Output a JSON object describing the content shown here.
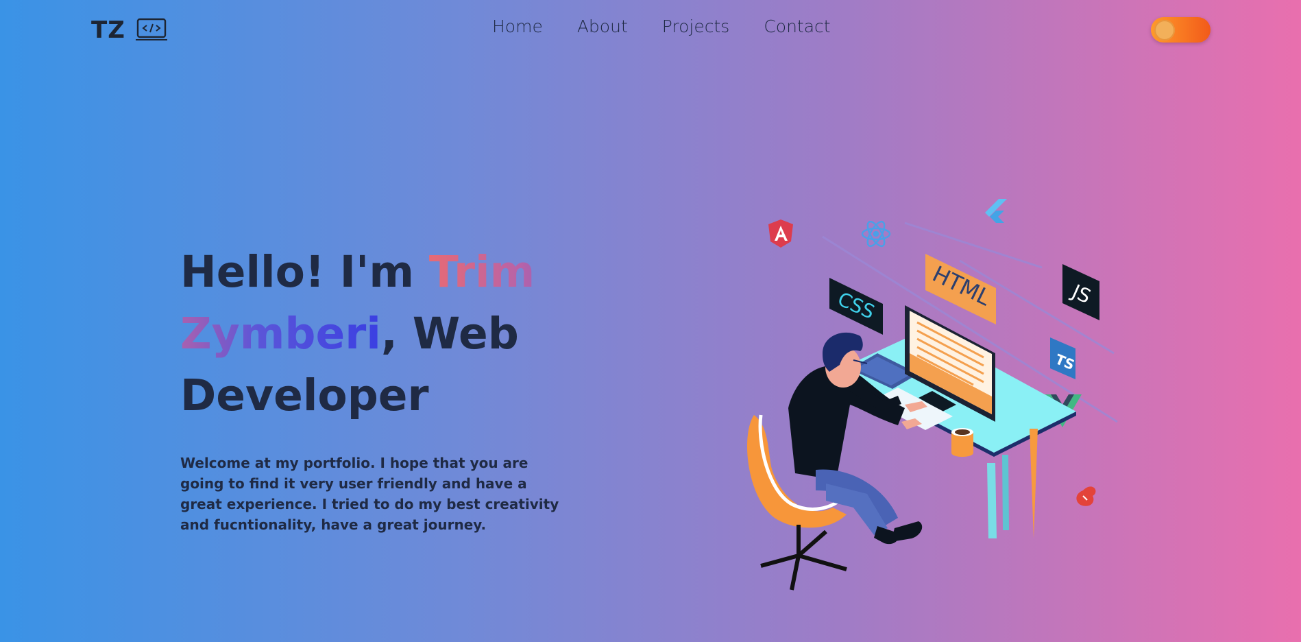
{
  "header": {
    "logo_text": "TZ",
    "logo_icon": "laptop-code-icon",
    "nav": [
      {
        "label": "Home"
      },
      {
        "label": "About"
      },
      {
        "label": "Projects"
      },
      {
        "label": "Contact"
      }
    ],
    "theme_toggle": {
      "icon": "toggle-switch",
      "state": "on"
    }
  },
  "hero": {
    "greeting": "Hello! I'm ",
    "name": "Trim Zymberi",
    "role": ", Web Developer",
    "description": "Welcome at my portfolio. I hope that you are going to find it very user friendly and have a great experience. I tried to do my best creativity and fucntionality, have a great journey."
  },
  "illustration": {
    "subject": "developer-at-desk-illustration",
    "labels": {
      "html": "HTML",
      "css": "CSS",
      "js": "JS",
      "ts": "TS"
    },
    "icons": [
      "angular-icon",
      "react-icon",
      "flutter-icon",
      "html-icon",
      "css-icon",
      "js-icon",
      "typescript-icon",
      "vue-icon",
      "svelte-icon"
    ]
  },
  "colors": {
    "accent_gradient_start": "#3a93e6",
    "accent_gradient_end": "#e96fae",
    "toggle": "#f25a1a",
    "text": "#1f2a44"
  }
}
